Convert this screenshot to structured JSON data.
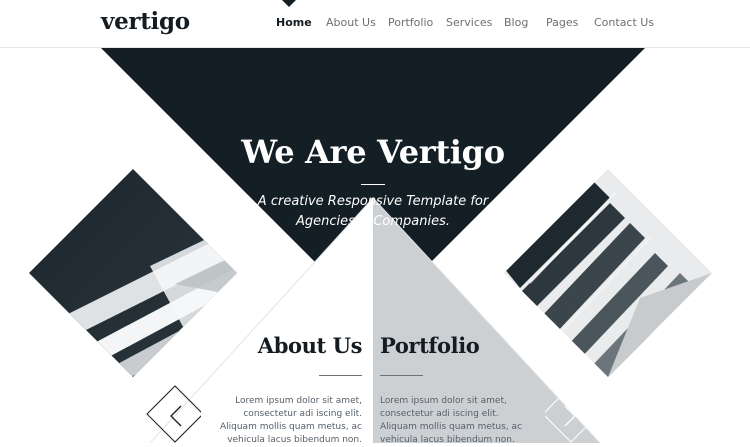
{
  "brand": {
    "logo": "vertigo"
  },
  "nav": {
    "items": [
      {
        "label": "Home",
        "active": true
      },
      {
        "label": "About Us"
      },
      {
        "label": "Portfolio"
      },
      {
        "label": "Services"
      },
      {
        "label": "Blog"
      },
      {
        "label": "Pages"
      },
      {
        "label": "Contact Us"
      }
    ]
  },
  "hero": {
    "title": "We Are Vertigo",
    "subtitle_lines": [
      "A creative Responsive Template for",
      "Agencies & Companies."
    ]
  },
  "about": {
    "title": "About Us",
    "lines": [
      "Lorem ipsum dolor sit amet,",
      "consectetur adi iscing elit.",
      "Aliquam mollis quam metus, ac",
      "vehicula lacus bibendum non."
    ]
  },
  "portfolio": {
    "title": "Portfolio",
    "lines": [
      "Lorem ipsum dolor sit amet,",
      "consectetur adi iscing elit.",
      "Aliquam mollis quam metus, ac",
      "vehicula lacus bibendum non."
    ]
  },
  "slider": {
    "prev_icon": "chevron-left-icon",
    "next_icon": "chevron-right-icon"
  },
  "colors": {
    "dark": "#141f25",
    "light_panel": "#cdd0d3",
    "text_dark": "#141c21",
    "nav_text": "#6a7075"
  }
}
